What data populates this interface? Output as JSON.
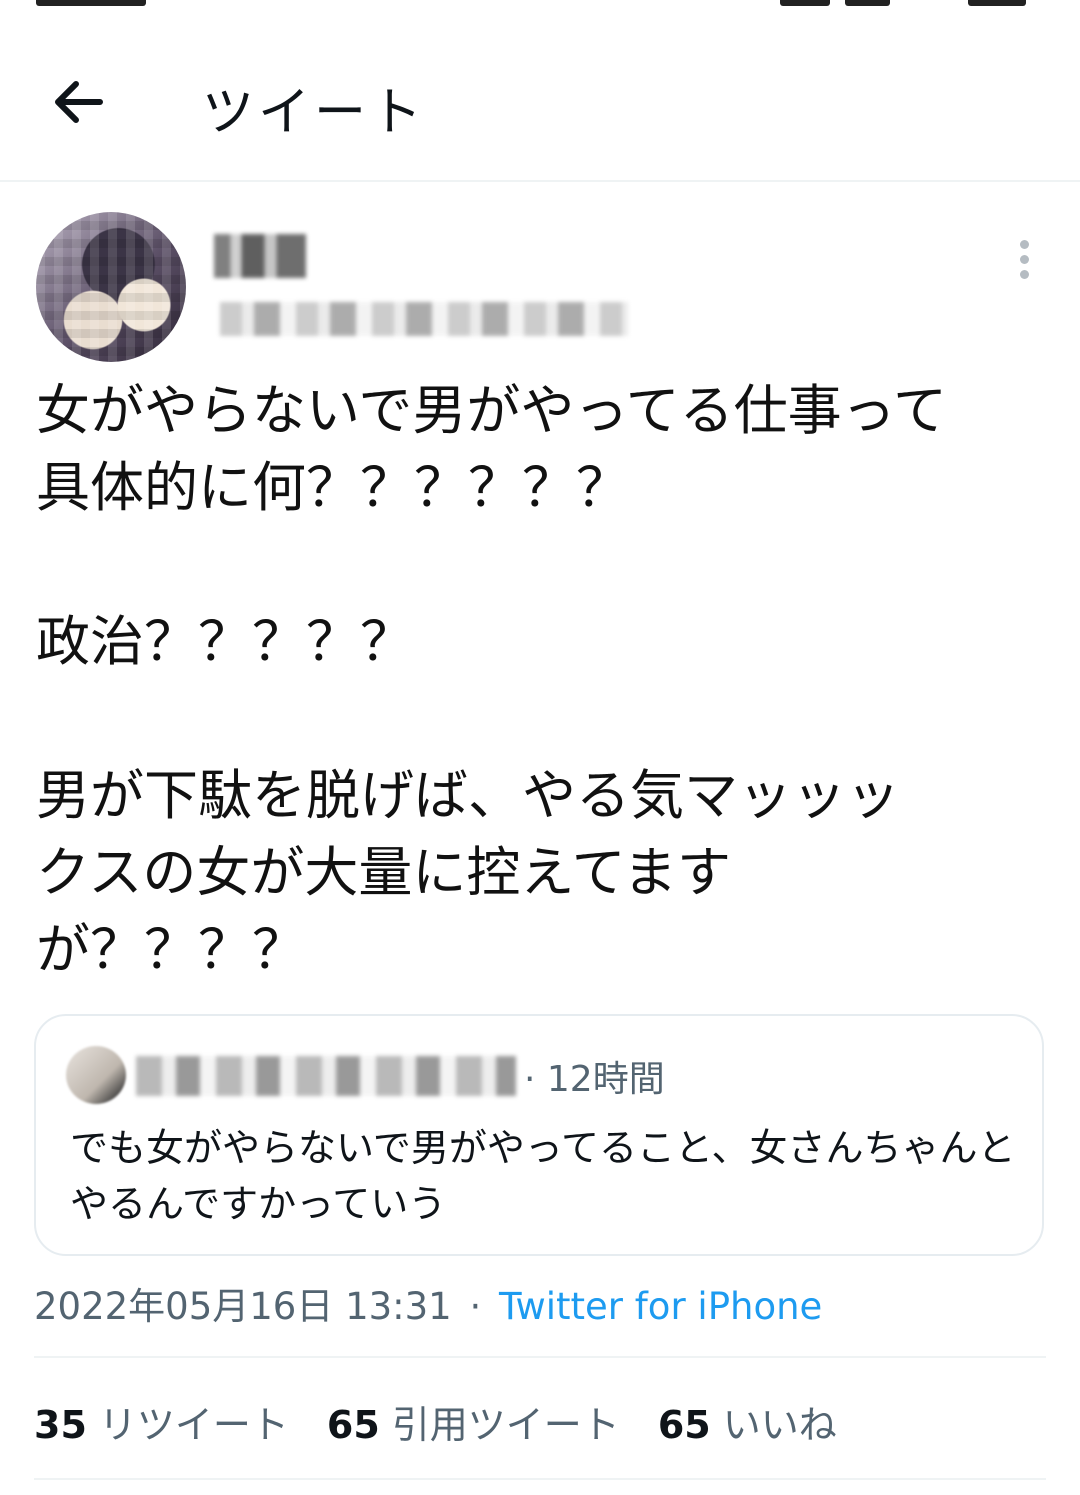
{
  "header": {
    "title": "ツイート",
    "back_icon": "arrow-left-icon"
  },
  "tweet": {
    "text": "女がやらないで男がやってる仕事って\n具体的に何？？？？？？\n\n政治？？？？？\n\n男が下駄を脱げば、やる気マッッッ\nクスの女が大量に控えてます\nが？？？？",
    "more_icon": "more-vertical-icon",
    "timestamp": "2022年05月16日 13:31",
    "separator": "·",
    "source": "Twitter for iPhone"
  },
  "quote": {
    "time": "· 12時間",
    "text": "でも女がやらないで男がやってること、女さんちゃんとやるんですかっていう"
  },
  "stats": {
    "retweets_count": "35",
    "retweets_label": "リツイート",
    "quotes_count": "65",
    "quotes_label": "引用ツイート",
    "likes_count": "65",
    "likes_label": "いいね"
  },
  "colors": {
    "link": "#1d9bf0",
    "secondary_text": "#536471",
    "divider": "#eff3f4"
  }
}
